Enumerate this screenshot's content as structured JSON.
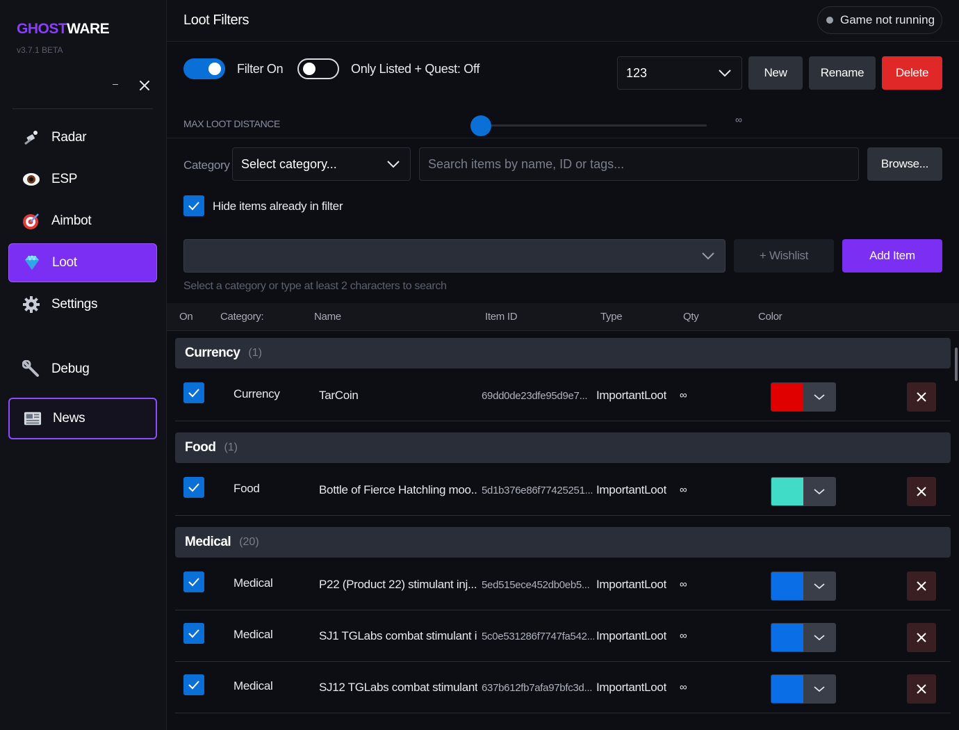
{
  "app": {
    "brand_a": "GHOST",
    "brand_b": "WARE",
    "version": "v3.7.1 BETA",
    "minimize": "–"
  },
  "nav": [
    {
      "label": "Radar",
      "icon": "satellite-icon"
    },
    {
      "label": "ESP",
      "icon": "eye-icon"
    },
    {
      "label": "Aimbot",
      "icon": "target-icon"
    },
    {
      "label": "Loot",
      "icon": "gem-icon"
    },
    {
      "label": "Settings",
      "icon": "gear-icon"
    },
    {
      "label": "Debug",
      "icon": "wrench-icon"
    },
    {
      "label": "News",
      "icon": "newspaper-icon"
    }
  ],
  "header": {
    "title": "Loot Filters",
    "status": "Game not running"
  },
  "filters": {
    "filter_on_label": "Filter On",
    "quest_label": "Only Listed + Quest: Off",
    "selected_filter": "123",
    "new_label": "New",
    "rename_label": "Rename",
    "delete_label": "Delete"
  },
  "distance": {
    "label": "MAX LOOT DISTANCE",
    "value": "∞"
  },
  "search": {
    "category_label": "Category",
    "category_placeholder": "Select category...",
    "search_placeholder": "Search items by name, ID or tags...",
    "browse_label": "Browse...",
    "hide_label": "Hide items already in filter",
    "wishlist_label": "+ Wishlist",
    "add_label": "Add Item",
    "hint": "Select a category or type at least 2 characters to search"
  },
  "columns": {
    "on": "On",
    "category": "Category:",
    "name": "Name",
    "item_id": "Item ID",
    "type": "Type",
    "qty": "Qty",
    "color": "Color"
  },
  "groups": [
    {
      "name": "Currency",
      "count": "(1)"
    },
    {
      "name": "Food",
      "count": "(1)"
    },
    {
      "name": "Medical",
      "count": "(20)"
    }
  ],
  "rows": [
    {
      "category": "Currency",
      "name": "TarCoin",
      "item_id": "69dd0de23dfe95d9e7...",
      "type": "ImportantLoot",
      "qty": "∞",
      "color": "#e00000"
    },
    {
      "category": "Food",
      "name": "Bottle of Fierce Hatchling moo...",
      "item_id": "5d1b376e86f77425251...",
      "type": "ImportantLoot",
      "qty": "∞",
      "color": "#40dcc8"
    },
    {
      "category": "Medical",
      "name": "P22 (Product 22) stimulant inj...",
      "item_id": "5ed515ece452db0eb5...",
      "type": "ImportantLoot",
      "qty": "∞",
      "color": "#0a6fe6"
    },
    {
      "category": "Medical",
      "name": "SJ1 TGLabs combat stimulant i...",
      "item_id": "5c0e531286f7747fa542...",
      "type": "ImportantLoot",
      "qty": "∞",
      "color": "#0a6fe6"
    },
    {
      "category": "Medical",
      "name": "SJ12 TGLabs combat stimulant...",
      "item_id": "637b612fb7afa97bfc3d...",
      "type": "ImportantLoot",
      "qty": "∞",
      "color": "#0a6fe6"
    }
  ]
}
